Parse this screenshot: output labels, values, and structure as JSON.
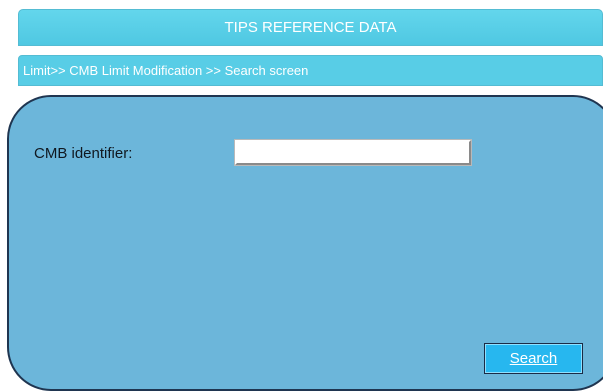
{
  "header": {
    "title": "TIPS REFERENCE DATA"
  },
  "breadcrumb": {
    "text": "Limit>> CMB Limit Modification >> Search screen"
  },
  "form": {
    "cmb_identifier_label": "CMB identifier:",
    "cmb_identifier_value": "",
    "search_label": "Search"
  },
  "colors": {
    "header_bar": "#58cde6",
    "panel_background": "#6cb6da",
    "panel_border": "#1f3550",
    "button_background": "#27b7ef"
  }
}
